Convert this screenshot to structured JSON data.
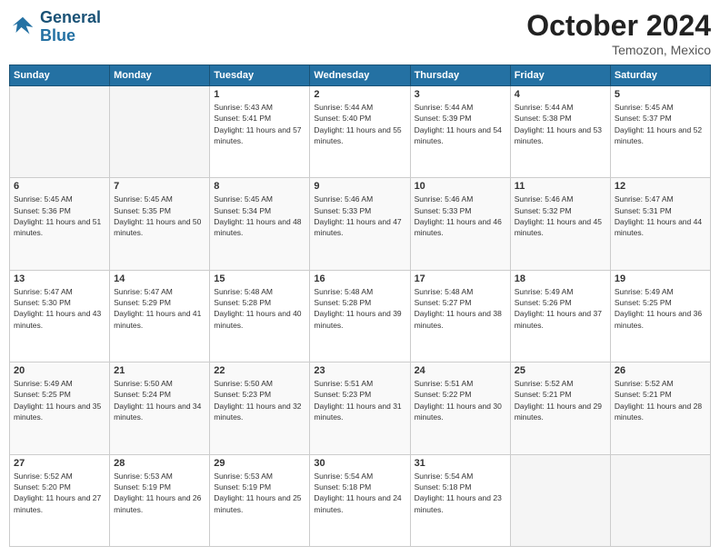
{
  "logo": {
    "line1": "General",
    "line2": "Blue"
  },
  "title": "October 2024",
  "location": "Temozon, Mexico",
  "days_header": [
    "Sunday",
    "Monday",
    "Tuesday",
    "Wednesday",
    "Thursday",
    "Friday",
    "Saturday"
  ],
  "weeks": [
    [
      {
        "day": "",
        "info": ""
      },
      {
        "day": "",
        "info": ""
      },
      {
        "day": "1",
        "info": "Sunrise: 5:43 AM\nSunset: 5:41 PM\nDaylight: 11 hours and 57 minutes."
      },
      {
        "day": "2",
        "info": "Sunrise: 5:44 AM\nSunset: 5:40 PM\nDaylight: 11 hours and 55 minutes."
      },
      {
        "day": "3",
        "info": "Sunrise: 5:44 AM\nSunset: 5:39 PM\nDaylight: 11 hours and 54 minutes."
      },
      {
        "day": "4",
        "info": "Sunrise: 5:44 AM\nSunset: 5:38 PM\nDaylight: 11 hours and 53 minutes."
      },
      {
        "day": "5",
        "info": "Sunrise: 5:45 AM\nSunset: 5:37 PM\nDaylight: 11 hours and 52 minutes."
      }
    ],
    [
      {
        "day": "6",
        "info": "Sunrise: 5:45 AM\nSunset: 5:36 PM\nDaylight: 11 hours and 51 minutes."
      },
      {
        "day": "7",
        "info": "Sunrise: 5:45 AM\nSunset: 5:35 PM\nDaylight: 11 hours and 50 minutes."
      },
      {
        "day": "8",
        "info": "Sunrise: 5:45 AM\nSunset: 5:34 PM\nDaylight: 11 hours and 48 minutes."
      },
      {
        "day": "9",
        "info": "Sunrise: 5:46 AM\nSunset: 5:33 PM\nDaylight: 11 hours and 47 minutes."
      },
      {
        "day": "10",
        "info": "Sunrise: 5:46 AM\nSunset: 5:33 PM\nDaylight: 11 hours and 46 minutes."
      },
      {
        "day": "11",
        "info": "Sunrise: 5:46 AM\nSunset: 5:32 PM\nDaylight: 11 hours and 45 minutes."
      },
      {
        "day": "12",
        "info": "Sunrise: 5:47 AM\nSunset: 5:31 PM\nDaylight: 11 hours and 44 minutes."
      }
    ],
    [
      {
        "day": "13",
        "info": "Sunrise: 5:47 AM\nSunset: 5:30 PM\nDaylight: 11 hours and 43 minutes."
      },
      {
        "day": "14",
        "info": "Sunrise: 5:47 AM\nSunset: 5:29 PM\nDaylight: 11 hours and 41 minutes."
      },
      {
        "day": "15",
        "info": "Sunrise: 5:48 AM\nSunset: 5:28 PM\nDaylight: 11 hours and 40 minutes."
      },
      {
        "day": "16",
        "info": "Sunrise: 5:48 AM\nSunset: 5:28 PM\nDaylight: 11 hours and 39 minutes."
      },
      {
        "day": "17",
        "info": "Sunrise: 5:48 AM\nSunset: 5:27 PM\nDaylight: 11 hours and 38 minutes."
      },
      {
        "day": "18",
        "info": "Sunrise: 5:49 AM\nSunset: 5:26 PM\nDaylight: 11 hours and 37 minutes."
      },
      {
        "day": "19",
        "info": "Sunrise: 5:49 AM\nSunset: 5:25 PM\nDaylight: 11 hours and 36 minutes."
      }
    ],
    [
      {
        "day": "20",
        "info": "Sunrise: 5:49 AM\nSunset: 5:25 PM\nDaylight: 11 hours and 35 minutes."
      },
      {
        "day": "21",
        "info": "Sunrise: 5:50 AM\nSunset: 5:24 PM\nDaylight: 11 hours and 34 minutes."
      },
      {
        "day": "22",
        "info": "Sunrise: 5:50 AM\nSunset: 5:23 PM\nDaylight: 11 hours and 32 minutes."
      },
      {
        "day": "23",
        "info": "Sunrise: 5:51 AM\nSunset: 5:23 PM\nDaylight: 11 hours and 31 minutes."
      },
      {
        "day": "24",
        "info": "Sunrise: 5:51 AM\nSunset: 5:22 PM\nDaylight: 11 hours and 30 minutes."
      },
      {
        "day": "25",
        "info": "Sunrise: 5:52 AM\nSunset: 5:21 PM\nDaylight: 11 hours and 29 minutes."
      },
      {
        "day": "26",
        "info": "Sunrise: 5:52 AM\nSunset: 5:21 PM\nDaylight: 11 hours and 28 minutes."
      }
    ],
    [
      {
        "day": "27",
        "info": "Sunrise: 5:52 AM\nSunset: 5:20 PM\nDaylight: 11 hours and 27 minutes."
      },
      {
        "day": "28",
        "info": "Sunrise: 5:53 AM\nSunset: 5:19 PM\nDaylight: 11 hours and 26 minutes."
      },
      {
        "day": "29",
        "info": "Sunrise: 5:53 AM\nSunset: 5:19 PM\nDaylight: 11 hours and 25 minutes."
      },
      {
        "day": "30",
        "info": "Sunrise: 5:54 AM\nSunset: 5:18 PM\nDaylight: 11 hours and 24 minutes."
      },
      {
        "day": "31",
        "info": "Sunrise: 5:54 AM\nSunset: 5:18 PM\nDaylight: 11 hours and 23 minutes."
      },
      {
        "day": "",
        "info": ""
      },
      {
        "day": "",
        "info": ""
      }
    ]
  ]
}
